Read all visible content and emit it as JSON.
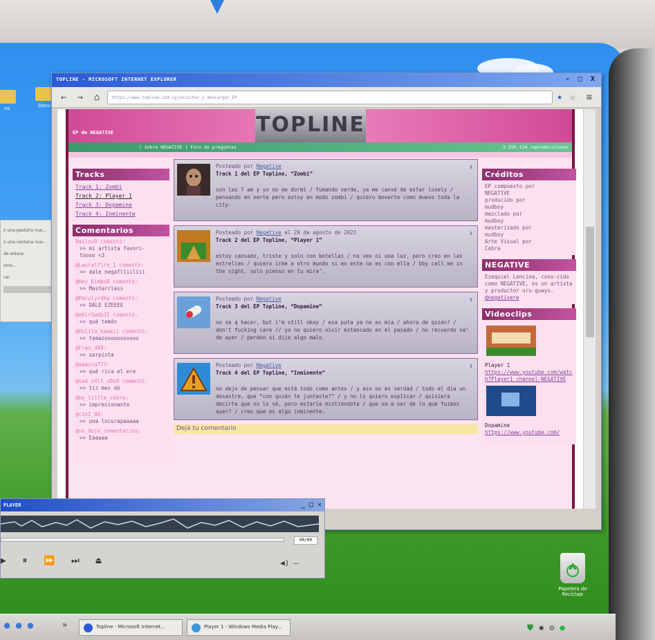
{
  "ie": {
    "title": "TOPLINE - MICROSOFT INTERNET EXPLORER",
    "controls": "- □ X",
    "address": "https://www.topline.com.uy/escuchar_y_descargar_EP"
  },
  "site": {
    "logo": "TOPLINE",
    "ep_tag": "EP de NEGATIVE",
    "nav": "| Sobre NEGATIVE | Foro de preguntas",
    "reproductions": "5.250.134 reproducciones",
    "tracks_heading": "Tracks",
    "tracks": [
      "Track 1: Zombi",
      "Track 2: Player 1",
      "Track 3: Dopamine",
      "Track 4: Inminente"
    ],
    "comments_heading": "Comentarios",
    "comments": [
      {
        "user": "Bailou9 comentó:",
        "text": ">> mi artista favori-\ntoooo <3"
      },
      {
        "user": "@Lauralfire_1 comentó:",
        "text": ">> dale negaflliiliii"
      },
      {
        "user": "@Hey_Kimbo8 comentó:",
        "text": ">> Masterclass"
      },
      {
        "user": "@Paculyrdkw comentó:",
        "text": ">> DALE EZEEEE"
      },
      {
        "user": "@eKirSwdb31 comentó:",
        "text": ">> qué temón"
      },
      {
        "user": "@Hulita_kawaii comentó:",
        "text": ">> temazooooooooooo"
      },
      {
        "user": "@Fran_d89:",
        "text": ">> zarpista"
      },
      {
        "user": "@aaaura777:",
        "text": ">> qué rica el ere"
      },
      {
        "user": "@sad_s4lt_u8o0 comentó:",
        "text": ">> tiz mes dó"
      },
      {
        "user": "@my_little_cobra:",
        "text": ">> impresionante"
      },
      {
        "user": "@cinI_00:",
        "text": ">> una locurapaaaaa"
      },
      {
        "user": "@no_deje_comentarios:",
        "text": ">> Eaaaaa"
      }
    ],
    "posts": [
      {
        "author_prefix": "Posteado por",
        "author": "Negative",
        "date": "",
        "title_prefix": "Track 1 del EP Topline, ",
        "title": "“Zombi”",
        "lyrics": "son las 7 am y yo no me dormí / fumando verde, ya me cansé de estar lonely / pensando en verte pero estoy en modo zombi / quiero moverte como muevo toda la city."
      },
      {
        "author_prefix": "Posteado por",
        "author": "Negative",
        "date": "el 20 de agosto de 2023",
        "title_prefix": "Track 2 del EP Topline, ",
        "title": "“Player 1”",
        "lyrics": "estoy cansado, triste y solo con botellas / no veo ni una luz, pero creo en las estrellas / quiero irme a otro mundo si en este no es con ella / bby call me in the night, solo pienso en tu mira’."
      },
      {
        "author_prefix": "Posteado por",
        "author": "Negative",
        "date": "",
        "title_prefix": "Track 3 del EP Topline, ",
        "title": "“Dopamine”",
        "lyrics": "no se q hacer, but i’m still okay / esa puta ya no es mía / ahora de quién? / don’t fucking care // ya no quiero vivir estancado en el pasado / no recuerdo na’ de ayer / perdón si dije algo malo."
      },
      {
        "author_prefix": "Posteado por",
        "author": "Negative",
        "date": "",
        "title_prefix": "Track 4 del EP Topline, ",
        "title": "“Inminente”",
        "lyrics": "no dejo de pensar que está todo como antes / y eso no es verdad / todo el día un desastre, que “con quién te juntaste?” / y no lo quiero explicar / quisiera decirte que no lo sé, pero estaría mintiéndote / que va a ser de lo que fuimos ayer? / creo que es algo inminente."
      }
    ],
    "comment_prompt": "Dejá tu comentario",
    "credits_heading": "Créditos",
    "credits": "EP compuesto por\n  NEGATIVE\nproducido por\n  mudboy\nmezclado por\n  mudboy\nmasterizado por\n  mudboy\nArte Visual por\n  Cebra",
    "artist_heading": "NEGATIVE",
    "artist_bio": "Ezequiel Lencina, cono-cido como NEGATIVE, es un artista y productor uru-guayo.",
    "artist_handle": "@negativere",
    "videos_heading": "Videoclips",
    "videos": [
      {
        "title": "Player 1",
        "url": "https://www.youtube.com/watch?Player1_channel-NEGATIVE"
      },
      {
        "title": "Dopamine",
        "url": "https://www.youtube.com/"
      }
    ]
  },
  "popup": {
    "items": [
      "n una pestaña nue...",
      "n una ventana nue...",
      "de enlace",
      "omo...",
      "rar"
    ]
  },
  "desktop": {
    "icons": [
      "os",
      "Docu"
    ],
    "recycle": "Papelera de Reciclaje"
  },
  "wmp": {
    "title": "PLAYER",
    "time": "00/00",
    "controls": "▶ ⏸ ⏩ ⏭ ⏏",
    "volume": "◀) —"
  },
  "taskbar": {
    "chevron": "»",
    "items": [
      "Topline - Microsoft Internet...",
      "Player 1 - Windows Media Play..."
    ]
  },
  "colors": {
    "site_pink": "#d04a96",
    "nav_green": "#3c9a6a",
    "box_header": "#8b2f6b",
    "title_blue": "#2a5bd6"
  }
}
